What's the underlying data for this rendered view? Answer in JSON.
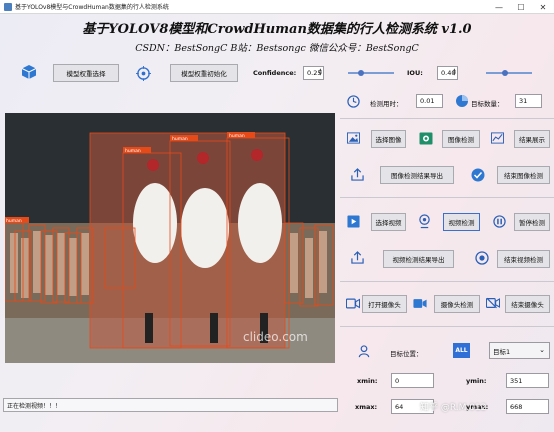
{
  "window": {
    "title": "基于YOLOv8模型与CrowdHuman数据集的行人检测系统",
    "minimize": "—",
    "maximize": "☐",
    "close": "✕"
  },
  "header": {
    "title": "基于YOLOV8模型和CrowdHuman数据集的行人检测系统 v1.0",
    "subtitle": "CSDN：BestSongC   B站：Bestsongc   微信公众号：BestSongC"
  },
  "toolbar": {
    "select_weights": "模型权重选择",
    "init_weights": "模型权重初始化",
    "confidence_label": "Confidence:",
    "confidence_value": "0.25",
    "iou_label": "IOU:",
    "iou_value": "0.40",
    "confidence_level": 0.25,
    "iou_level": 0.4
  },
  "stats": {
    "time_label": "检测用时：",
    "time_value": "0.01",
    "count_label": "目标数量：",
    "count_value": "31"
  },
  "image": {
    "select": "选择图像",
    "detect": "图像检测",
    "show": "结果展示",
    "export": "图像检测结果导出",
    "stop": "结束图像检测"
  },
  "video": {
    "select": "选择视频",
    "detect": "视频检测",
    "pause": "暂停检测",
    "export": "视频检测结果导出",
    "stop": "结束视频检测"
  },
  "camera": {
    "open": "打开摄像头",
    "detect": "摄像头检测",
    "stop": "结束摄像头"
  },
  "target": {
    "label": "目标位置：",
    "all_icon": "ALL",
    "selected": "目标1",
    "xmin_label": "xmin:",
    "xmin_value": "0",
    "ymin_label": "ymin:",
    "ymin_value": "351",
    "xmax_label": "xmax:",
    "xmax_value": "64",
    "ymax_label": "ymax:",
    "ymax_value": "668"
  },
  "viewer": {
    "watermark": "clideo.com",
    "person_label": "human"
  },
  "status": {
    "text": "正在检测视频！！！"
  },
  "overlay": {
    "watermark": "知乎 @R.M.012"
  },
  "colors": {
    "accent": "#3b6fcf",
    "box": "#e64a19"
  }
}
